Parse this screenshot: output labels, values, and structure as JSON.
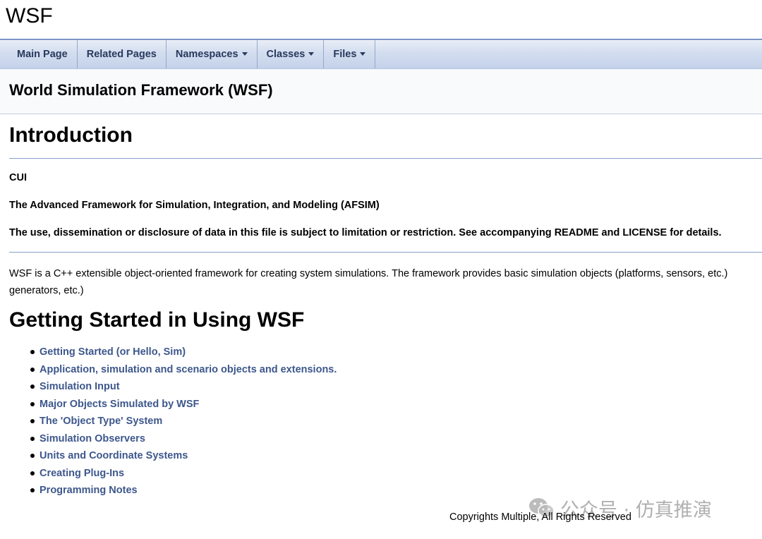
{
  "project_name": "WSF",
  "navbar": {
    "items": [
      {
        "label": "Main Page",
        "dropdown": false
      },
      {
        "label": "Related Pages",
        "dropdown": false
      },
      {
        "label": "Namespaces",
        "dropdown": true
      },
      {
        "label": "Classes",
        "dropdown": true
      },
      {
        "label": "Files",
        "dropdown": true
      }
    ]
  },
  "header": {
    "title": "World Simulation Framework (WSF)"
  },
  "content": {
    "intro_heading": "Introduction",
    "bold_lines": [
      "CUI",
      "The Advanced Framework for Simulation, Integration, and Modeling (AFSIM)",
      "The use, dissemination or disclosure of data in this file is subject to limitation or restriction. See accompanying README and LICENSE for details."
    ],
    "description": "WSF is a C++ extensible object-oriented framework for creating system simulations. The framework provides basic simulation objects (platforms, sensors, etc.) generators, etc.)",
    "started_heading": "Getting Started in Using WSF",
    "links": [
      "Getting Started (or Hello, Sim)",
      "Application, simulation and scenario objects and extensions.",
      "Simulation Input",
      "Major Objects Simulated by WSF",
      "The 'Object Type' System",
      "Simulation Observers",
      "Units and Coordinate Systems",
      "Creating Plug-Ins",
      "Programming Notes"
    ]
  },
  "footer": {
    "copyright": "Copyrights Multiple, All Rights Reserved"
  },
  "watermark": {
    "text": "公众号 · 仿真推演",
    "icon": "wechat-icon"
  },
  "colors": {
    "link": "#3D578C",
    "nav_text": "#283A5D",
    "rule": "#879ECB"
  }
}
